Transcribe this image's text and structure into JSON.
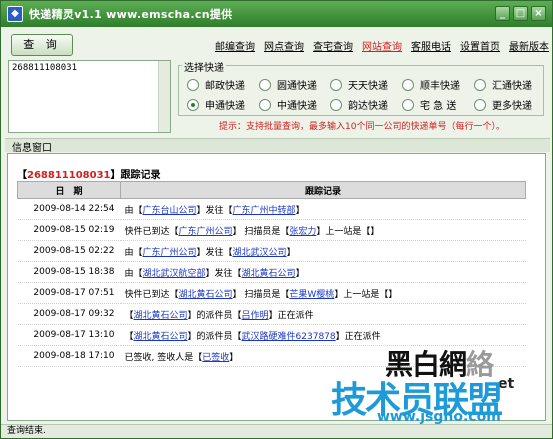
{
  "window": {
    "title": "快递精灵v1.1 www.emscha.cn提供"
  },
  "toolbar": {
    "query_label": "查 询",
    "links": [
      {
        "label": "邮编查询",
        "active": false
      },
      {
        "label": "网点查询",
        "active": false
      },
      {
        "label": "查宅查询",
        "active": false
      },
      {
        "label": "网站查询",
        "active": true
      },
      {
        "label": "客服电话",
        "active": false
      },
      {
        "label": "设置首页",
        "active": false
      },
      {
        "label": "最新版本",
        "active": false
      }
    ]
  },
  "input": {
    "value": "268811108031"
  },
  "express": {
    "legend": "选择快递",
    "options": [
      {
        "label": "邮政快递",
        "selected": false
      },
      {
        "label": "圆通快递",
        "selected": false
      },
      {
        "label": "天天快递",
        "selected": false
      },
      {
        "label": "顺丰快递",
        "selected": false
      },
      {
        "label": "汇通快递",
        "selected": false
      },
      {
        "label": "申通快递",
        "selected": true
      },
      {
        "label": "中通快递",
        "selected": false
      },
      {
        "label": "韵达快递",
        "selected": false
      },
      {
        "label": "宅 急 送",
        "selected": false
      },
      {
        "label": "更多快递",
        "selected": false
      }
    ],
    "tip": "提示：支持批量查询，最多输入10个同一公司的快递单号（每行一个）。"
  },
  "info": {
    "tab_label": "信息窗口",
    "record_prefix": "【",
    "record_number": "268811108031",
    "record_suffix": "】跟踪记录",
    "headers": {
      "date": "日　期",
      "record": "跟踪记录"
    },
    "rows": [
      {
        "date": "2009-08-14 22:54",
        "parts": [
          {
            "t": "由【"
          },
          {
            "t": "广东台山公司",
            "h": true
          },
          {
            "t": "】发往【"
          },
          {
            "t": "广东广州中转部",
            "h": true
          },
          {
            "t": "】"
          }
        ]
      },
      {
        "date": "2009-08-15 02:19",
        "parts": [
          {
            "t": "快件已到达【"
          },
          {
            "t": "广东广州公司",
            "h": true
          },
          {
            "t": "】 扫描员是【"
          },
          {
            "t": "张宏力",
            "h": true
          },
          {
            "t": "】上一站是【】"
          }
        ]
      },
      {
        "date": "2009-08-15 02:22",
        "parts": [
          {
            "t": "由【"
          },
          {
            "t": "广东广州公司",
            "h": true
          },
          {
            "t": "】发往【"
          },
          {
            "t": "湖北武汉公司",
            "h": true
          },
          {
            "t": "】"
          }
        ]
      },
      {
        "date": "2009-08-15 18:38",
        "parts": [
          {
            "t": "由【"
          },
          {
            "t": "湖北武汉航空部",
            "h": true
          },
          {
            "t": "】发往【"
          },
          {
            "t": "湖北黄石公司",
            "h": true
          },
          {
            "t": "】"
          }
        ]
      },
      {
        "date": "2009-08-17 07:51",
        "parts": [
          {
            "t": "快件已到达【"
          },
          {
            "t": "湖北黄石公司",
            "h": true
          },
          {
            "t": "】 扫描员是【"
          },
          {
            "t": "芒果W樱桃",
            "h": true
          },
          {
            "t": "】上一站是【】"
          }
        ]
      },
      {
        "date": "2009-08-17 09:32",
        "parts": [
          {
            "t": "【"
          },
          {
            "t": "湖北黄石公司",
            "h": true
          },
          {
            "t": "】的派件员【"
          },
          {
            "t": "吕作明",
            "h": true
          },
          {
            "t": "】正在派件"
          }
        ]
      },
      {
        "date": "2009-08-17 13:10",
        "parts": [
          {
            "t": "【"
          },
          {
            "t": "湖北黄石公司",
            "h": true
          },
          {
            "t": "】的派件员【"
          },
          {
            "t": "武汉路硬难件6237878",
            "h": true
          },
          {
            "t": "】正在派件"
          }
        ]
      },
      {
        "date": "2009-08-18 17:10",
        "parts": [
          {
            "t": "已签收, 签收人是【"
          },
          {
            "t": "已签收",
            "h": true
          },
          {
            "t": "】"
          }
        ]
      }
    ]
  },
  "watermark": {
    "line1": "黑白網絡",
    "line2": "技术员联盟",
    "line3": "www.jsgho.com",
    "side": "et"
  },
  "status": {
    "text": "查询结束."
  }
}
